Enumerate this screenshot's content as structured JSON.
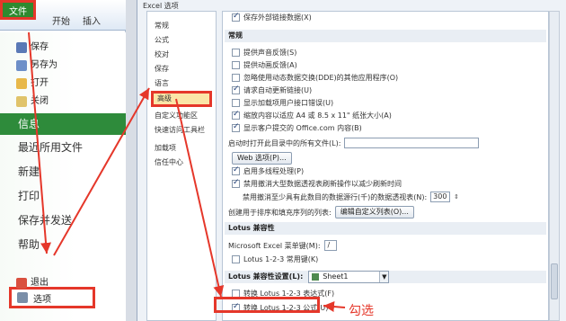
{
  "ribbon": {
    "file_tab": "文件",
    "start_tab": "开始",
    "insert_tab": "插入"
  },
  "file_menu": {
    "save": "保存",
    "save_as": "另存为",
    "open": "打开",
    "close": "关闭",
    "info": "信息",
    "recent": "最近所用文件",
    "new": "新建",
    "print": "打印",
    "save_send": "保存并发送",
    "help": "帮助",
    "options": "选项",
    "exit": "退出"
  },
  "dialog": {
    "title": "Excel 选项",
    "nav": [
      "常规",
      "公式",
      "校对",
      "保存",
      "语言",
      "高级",
      "自定义功能区",
      "快速访问工具栏",
      "加载项",
      "信任中心"
    ],
    "top_item": "保存外部链接数据(X)",
    "general_section": "常规",
    "general_items": [
      {
        "label": "提供声音反馈(S)",
        "checked": false
      },
      {
        "label": "提供动画反馈(A)",
        "checked": false
      },
      {
        "label": "忽略使用动态数据交换(DDE)的其他应用程序(O)",
        "checked": false
      },
      {
        "label": "请求自动更新链接(U)",
        "checked": true
      },
      {
        "label": "显示加载项用户接口错误(U)",
        "checked": false
      },
      {
        "label": "缩放内容以适应 A4 或 8.5 x 11\" 纸张大小(A)",
        "checked": true
      },
      {
        "label": "显示客户提交的 Office.com 内容(B)",
        "checked": true
      }
    ],
    "startup_label": "启动时打开此目录中的所有文件(L):",
    "web_options_button": "Web 选项(P)...",
    "multithread": {
      "label": "启用多线程处理(P)",
      "checked": true
    },
    "disable_undo": {
      "label": "禁用撤消大型数据透视表刷新操作以减少刷新时间",
      "checked": true
    },
    "undo_rows_label": "禁用撤消至少具有此数目的数据源行(千)的数据透视表(N):",
    "undo_rows_value": "300",
    "custom_list_label": "创建用于排序和填充序列的列表:",
    "custom_list_button": "编辑自定义列表(O)...",
    "lotus_section": "Lotus 兼容性",
    "lotus_menu_key_label": "Microsoft Excel 菜单键(M):",
    "lotus_menu_key_value": "/",
    "lotus_nav_keys": {
      "label": "Lotus 1-2-3 常用键(K)",
      "checked": false
    },
    "lotus_settings_label": "Lotus 兼容性设置(L):",
    "lotus_settings_sheet": "Sheet1",
    "lotus_transition_eval": {
      "label": "转换 Lotus 1-2-3 表达式(F)",
      "checked": false
    },
    "lotus_transition_formula": {
      "label": "转换 Lotus 1-2-3 公式(U)",
      "checked": true
    },
    "annotation": "勾选"
  },
  "colors": {
    "accent_green": "#2e8b3b",
    "annotation_red": "#e5372a",
    "nav_selected": "#fbe5a7"
  }
}
